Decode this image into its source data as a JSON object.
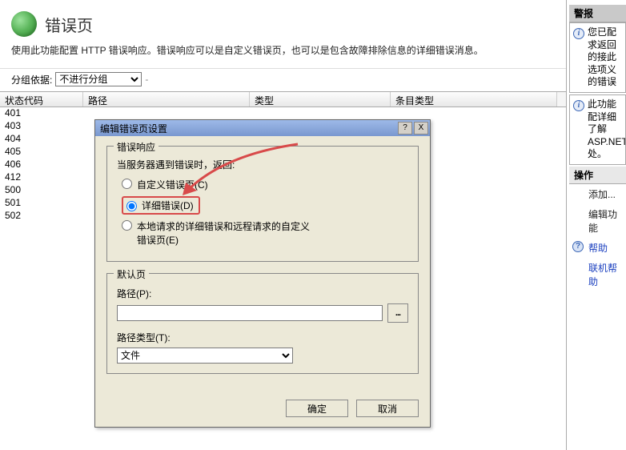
{
  "header": {
    "title": "错误页"
  },
  "desc": "使用此功能配置 HTTP 错误响应。错误响应可以是自定义错误页，也可以是包含故障排除信息的详细错误消息。",
  "group": {
    "label": "分组依据:",
    "value": "不进行分组",
    "dash": "-"
  },
  "table": {
    "th1": "状态代码",
    "th2": "路径",
    "th3": "类型",
    "th4": "条目类型",
    "rows": [
      "401",
      "403",
      "404",
      "405",
      "406",
      "412",
      "500",
      "501",
      "502"
    ]
  },
  "dialog": {
    "title": "编辑错误页设置",
    "group1": {
      "legend": "错误响应",
      "note": "当服务器遇到错误时，返回:",
      "opt1": "自定义错误页(C)",
      "opt2": "详细错误(D)",
      "opt3": "本地请求的详细错误和远程请求的自定义错误页(E)"
    },
    "group2": {
      "legend": "默认页",
      "path_label": "路径(P):",
      "path_value": "",
      "browse": "...",
      "type_label": "路径类型(T):",
      "type_value": "文件"
    },
    "ok": "确定",
    "cancel": "取消",
    "help": "?",
    "close": "X"
  },
  "side": {
    "alertTitle": "警报",
    "a1": "您已配求返回的接此选项义的错误",
    "a2": "此功能配详细了解ASP.NET处。",
    "actionsTitle": "操作",
    "add": "添加...",
    "edit": "编辑功能",
    "help": "帮助",
    "online": "联机帮助"
  }
}
